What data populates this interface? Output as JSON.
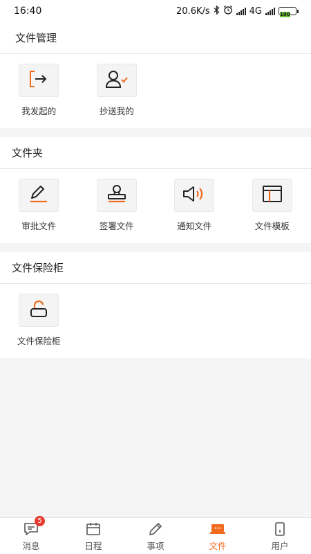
{
  "status_bar": {
    "time": "16:40",
    "net_speed": "20.6K/s",
    "network": "4G",
    "battery": "100"
  },
  "sections": {
    "file_management": {
      "title": "文件管理",
      "items": [
        {
          "label": "我发起的",
          "icon": "export-icon"
        },
        {
          "label": "抄送我的",
          "icon": "user-check-icon"
        }
      ]
    },
    "folders": {
      "title": "文件夹",
      "items": [
        {
          "label": "审批文件",
          "icon": "pen-icon"
        },
        {
          "label": "签署文件",
          "icon": "stamp-icon"
        },
        {
          "label": "通知文件",
          "icon": "speaker-icon"
        },
        {
          "label": "文件模板",
          "icon": "template-icon"
        }
      ]
    },
    "vault": {
      "title": "文件保险柜",
      "items": [
        {
          "label": "文件保险柜",
          "icon": "unlock-icon"
        }
      ]
    }
  },
  "tabbar": {
    "items": [
      {
        "label": "消息",
        "icon": "message-icon",
        "badge": "5"
      },
      {
        "label": "日程",
        "icon": "calendar-icon"
      },
      {
        "label": "事项",
        "icon": "edit-icon"
      },
      {
        "label": "文件",
        "icon": "file-box-icon",
        "active": true
      },
      {
        "label": "用户",
        "icon": "user-device-icon"
      }
    ]
  },
  "colors": {
    "accent": "#f06a1d",
    "badge": "#e63a2e",
    "battery": "#6ec23a"
  }
}
